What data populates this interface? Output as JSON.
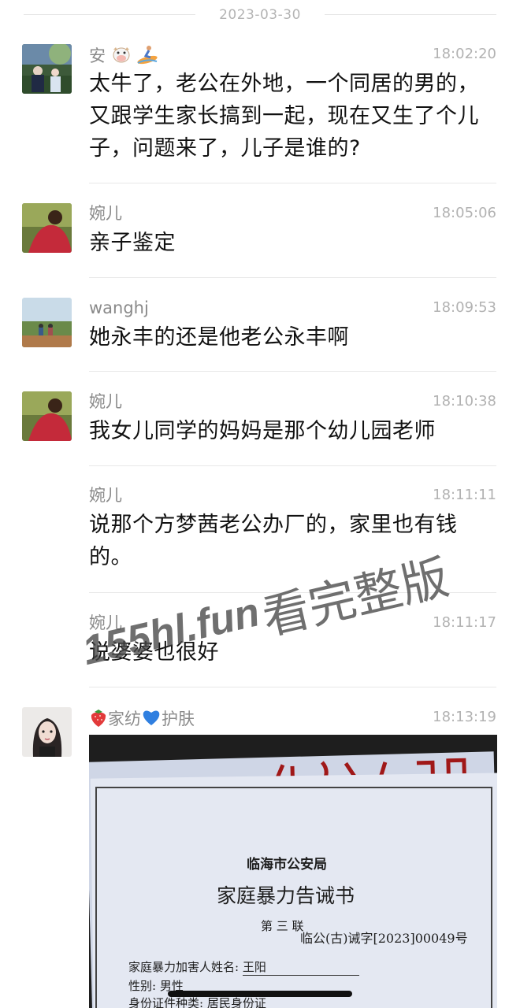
{
  "date_separator": "2023-03-30",
  "messages": [
    {
      "name": "安",
      "time": "18:02:20",
      "text_lines": [
        "太牛了，老公在外地，一个同居的男的，",
        "又跟学生家长搞到一起，现在又生了个儿",
        "子，问题来了，儿子是谁的?"
      ]
    },
    {
      "name": "婉儿",
      "time": "18:05:06",
      "text_lines": [
        "亲子鉴定"
      ]
    },
    {
      "name": "wanghj",
      "time": "18:09:53",
      "text_lines": [
        "她永丰的还是他老公永丰啊"
      ]
    },
    {
      "name": "婉儿",
      "time": "18:10:38",
      "text_lines": [
        "我女儿同学的妈妈是那个幼儿园老师"
      ]
    },
    {
      "name": "婉儿",
      "time": "18:11:11",
      "text_lines": [
        "说那个方梦茜老公办厂的，家里也有钱",
        "的。"
      ]
    },
    {
      "name": "婉儿",
      "time": "18:11:17",
      "text_lines": [
        "说婆婆也很好"
      ]
    },
    {
      "name_parts": [
        "家纺",
        "护肤"
      ],
      "time": "18:13:19"
    }
  ],
  "watermark": {
    "site": "155hl.fun",
    "label": "看完整版"
  },
  "document": {
    "issuer": "临海市公安局",
    "title": "家庭暴力告诫书",
    "copy": "第 三 联",
    "number": "临公(古)诫字[2023]00049号",
    "field_name_label": "家庭暴力加害人姓名:",
    "field_name_value": "王阳",
    "field_sex_label": "性别:",
    "field_sex_value": "男性",
    "field_id_label": "身份证件种类:",
    "field_id_value": "居民身份证"
  },
  "icons": [
    "cow-emoji-icon",
    "surfer-emoji-icon",
    "strawberry-emoji-icon",
    "blue-heart-emoji-icon"
  ],
  "colors": {
    "name_text": "#8a8a8a",
    "time_text": "#b2b2b2",
    "message_text": "#111111",
    "divider": "#e8e8e8"
  }
}
